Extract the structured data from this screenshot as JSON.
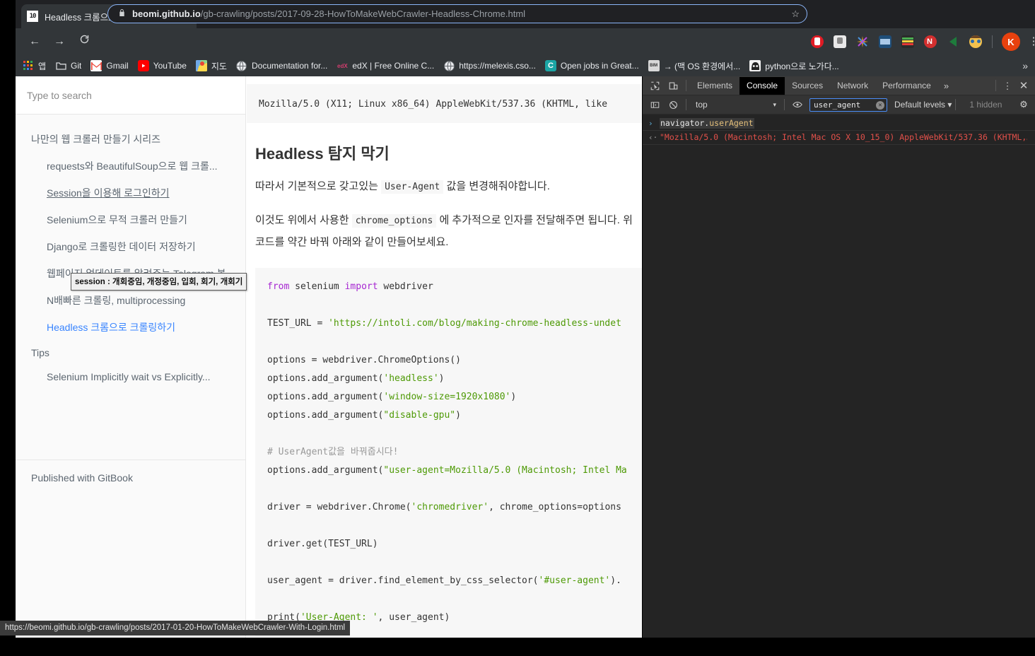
{
  "browser": {
    "tab": {
      "favicon_glyph": "10",
      "title": "Headless 크롬으로 크롤링하기 · Git",
      "close_label": "✕"
    },
    "new_tab_label": "+",
    "nav": {
      "back": "←",
      "forward": "→",
      "reload": "C"
    },
    "omnibox": {
      "lock_icon": "🔒",
      "domain": "beomi.github.io",
      "path": "/gb-crawling/posts/2017-09-28-HowToMakeWebCrawler-Headless-Chrome.html",
      "star_icon": "☆"
    },
    "menu_glyph": "⋮",
    "profile_initial": "K",
    "bookmarks": [
      {
        "label": "앱",
        "icon": "apps-grid-icon"
      },
      {
        "label": "Git",
        "icon": "folder-icon"
      },
      {
        "label": "Gmail",
        "icon": "gmail-icon"
      },
      {
        "label": "YouTube",
        "icon": "youtube-icon"
      },
      {
        "label": "지도",
        "icon": "maps-icon"
      },
      {
        "label": "Documentation for...",
        "icon": "globe-icon"
      },
      {
        "label": "edX | Free Online C...",
        "icon": "edx-icon"
      },
      {
        "label": "https://melexis.cso...",
        "icon": "globe-icon"
      },
      {
        "label": "Open jobs in Great...",
        "icon": "c-letter-icon"
      },
      {
        "label": "→ (맥 OS 환경에서...",
        "icon": "bim-icon"
      },
      {
        "label": "python으로 노가다...",
        "icon": "dark-avatar-icon"
      }
    ],
    "bookmarks_overflow": "»"
  },
  "sidebar": {
    "search_placeholder": "Type to search",
    "sections": [
      {
        "heading": "나만의 웹 크롤러 만들기 시리즈",
        "items": [
          {
            "label": "requests와 BeautifulSoup으로 웹 크롤...",
            "state": "normal"
          },
          {
            "label": "Session을 이용해 로그인하기",
            "state": "hovered"
          },
          {
            "label": "Selenium으로 무적 크롤러 만들기",
            "state": "normal"
          },
          {
            "label": "Django로 크롤링한 데이터 저장하기",
            "state": "normal"
          },
          {
            "label": "웹페이지 업데이트를 알려주는 Telegram 봇",
            "state": "normal"
          },
          {
            "label": "N배빠른 크롤링, multiprocessing",
            "state": "normal"
          },
          {
            "label": "Headless 크롬으로 크롤링하기",
            "state": "active"
          }
        ]
      },
      {
        "heading": "Tips",
        "items": [
          {
            "label": "Selenium Implicitly wait vs Explicitly...",
            "state": "normal"
          }
        ]
      }
    ],
    "footer": "Published with GitBook",
    "tooltip": "session : 개회중임, 개정중임, 입회, 회기, 개회기"
  },
  "article": {
    "top_pre": "Mozilla/5.0 (X11; Linux x86_64) AppleWebKit/537.36 (KHTML, like ",
    "heading": "Headless 탐지 막기",
    "para1_before": "따라서 기본적으로 갖고있는 ",
    "para1_code": "User-Agent",
    "para1_after": " 값을 변경해줘야합니다.",
    "para2_before": "이것도 위에서 사용한 ",
    "para2_code": "chrome_options",
    "para2_after": " 에 추가적으로 인자를 전달해주면 됩니다. 위 코드를 약간 바꿔 아래와 같이 만들어보세요.",
    "code_lines": [
      [
        {
          "t": "from ",
          "c": "kw"
        },
        {
          "t": "selenium ",
          "c": ""
        },
        {
          "t": "import ",
          "c": "kw"
        },
        {
          "t": "webdriver",
          "c": ""
        }
      ],
      [],
      [
        {
          "t": "TEST_URL = ",
          "c": ""
        },
        {
          "t": "'https://intoli.com/blog/making-chrome-headless-undet",
          "c": "str"
        }
      ],
      [],
      [
        {
          "t": "options = webdriver.ChromeOptions()",
          "c": ""
        }
      ],
      [
        {
          "t": "options.add_argument(",
          "c": ""
        },
        {
          "t": "'headless'",
          "c": "str"
        },
        {
          "t": ")",
          "c": ""
        }
      ],
      [
        {
          "t": "options.add_argument(",
          "c": ""
        },
        {
          "t": "'window-size=1920x1080'",
          "c": "str"
        },
        {
          "t": ")",
          "c": ""
        }
      ],
      [
        {
          "t": "options.add_argument(",
          "c": ""
        },
        {
          "t": "\"disable-gpu\"",
          "c": "str"
        },
        {
          "t": ")",
          "c": ""
        }
      ],
      [],
      [
        {
          "t": "# UserAgent값을 바꿔줍시다!",
          "c": "cm"
        }
      ],
      [
        {
          "t": "options.add_argument(",
          "c": ""
        },
        {
          "t": "\"user-agent=Mozilla/5.0 (Macintosh; Intel Ma",
          "c": "str"
        }
      ],
      [],
      [
        {
          "t": "driver = webdriver.Chrome(",
          "c": ""
        },
        {
          "t": "'chromedriver'",
          "c": "str"
        },
        {
          "t": ", chrome_options=options",
          "c": ""
        }
      ],
      [],
      [
        {
          "t": "driver.get(TEST_URL)",
          "c": ""
        }
      ],
      [],
      [
        {
          "t": "user_agent = driver.find_element_by_css_selector(",
          "c": ""
        },
        {
          "t": "'#user-agent'",
          "c": "str"
        },
        {
          "t": ").",
          "c": ""
        }
      ],
      [],
      [
        {
          "t": "print(",
          "c": ""
        },
        {
          "t": "'User-Agent: '",
          "c": "str"
        },
        {
          "t": ", user_agent)",
          "c": ""
        }
      ]
    ]
  },
  "devtools": {
    "tabs": [
      {
        "label": "Elements",
        "selected": false
      },
      {
        "label": "Console",
        "selected": true
      },
      {
        "label": "Sources",
        "selected": false
      },
      {
        "label": "Network",
        "selected": false
      },
      {
        "label": "Performance",
        "selected": false
      }
    ],
    "more_tabs": "»",
    "kebab": "⋮",
    "close": "✕",
    "context": "top",
    "context_caret": "▾",
    "filter_value": "user_agent",
    "filter_clear": "✕",
    "levels": "Default levels ▾",
    "hidden": "1 hidden",
    "gear": "⚙",
    "console": [
      {
        "kind": "input",
        "arrow": "›",
        "expression_obj": "navigator.",
        "expression_prop": "userAgent"
      },
      {
        "kind": "output",
        "arrow": "‹·",
        "text": "\"Mozilla/5.0 (Macintosh; Intel Mac OS X 10_15_0) AppleWebKit/537.36 (KHTML,…"
      }
    ]
  },
  "status_bar": {
    "url": "https://beomi.github.io/gb-crawling/posts/2017-01-20-HowToMakeWebCrawler-With-Login.html"
  },
  "colors": {
    "accent_blue": "#8ab4f8",
    "link_blue": "#3884ff",
    "console_error_red": "#e2504a",
    "string_green": "#4e9a06",
    "keyword_purple": "#a626d1"
  }
}
